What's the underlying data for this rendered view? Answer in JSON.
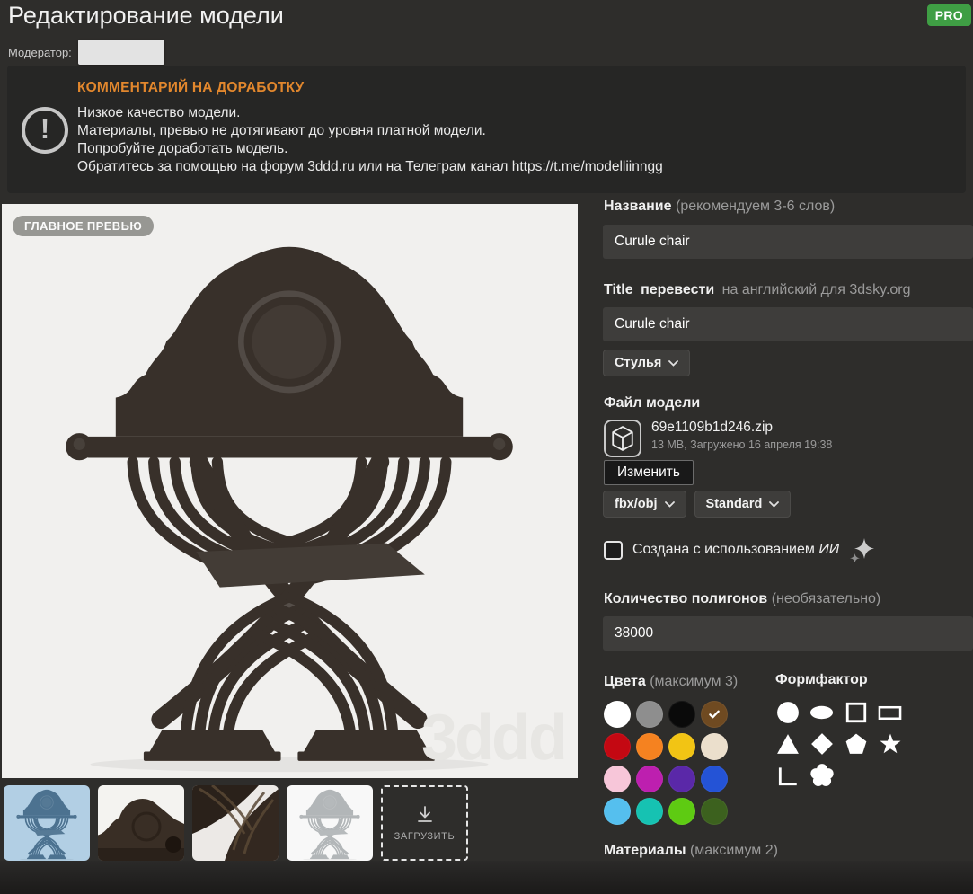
{
  "page": {
    "title": "Редактирование модели",
    "pro_badge": "PRO",
    "moderator_label": "Модератор:"
  },
  "warning": {
    "heading": "КОММЕНТАРИЙ НА ДОРАБОТКУ",
    "lines": [
      "Низкое качество модели.",
      "Материалы, превью не дотягивают до уровня платной модели.",
      "Попробуйте доработать модель.",
      "Обратитесь за помощью на форум 3ddd.ru или на Телеграм канал https://t.me/modelliinngg"
    ]
  },
  "preview": {
    "main_badge": "ГЛАВНОЕ ПРЕВЬЮ",
    "watermark": "3ddd",
    "upload_label": "ЗАГРУЗИТЬ",
    "thumbnails": [
      {
        "id": 1,
        "variant": "blue-selected"
      },
      {
        "id": 2,
        "variant": "crest-closeup"
      },
      {
        "id": 3,
        "variant": "legs-closeup"
      },
      {
        "id": 4,
        "variant": "wireframe"
      }
    ]
  },
  "form": {
    "name": {
      "label": "Название",
      "hint": "(рекомендуем 3-6 слов)",
      "value": "Curule chair"
    },
    "title_en": {
      "label": "Title",
      "action": "перевести",
      "hint": "на английский для 3dsky.org",
      "value": "Curule chair"
    },
    "category": {
      "value": "Стулья"
    },
    "file": {
      "section_label": "Файл модели",
      "filename": "69e1109b1d246.zip",
      "meta": "13 MB, Загружено 16 апреля 19:38",
      "change_button": "Изменить",
      "format_dropdown": "fbx/obj",
      "render_dropdown": "Standard"
    },
    "ai_checkbox": {
      "label_prefix": "Создана с использованием",
      "label_em": "ИИ",
      "checked": false
    },
    "polygons": {
      "label": "Количество полигонов",
      "hint": "(необязательно)",
      "value": "38000"
    },
    "colors": {
      "label": "Цвета",
      "hint": "(максимум 3)",
      "swatches": [
        {
          "name": "white",
          "hex": "#ffffff",
          "selected": false
        },
        {
          "name": "gray",
          "hex": "#8e8e8e",
          "selected": false
        },
        {
          "name": "black",
          "hex": "#0a0a0a",
          "selected": false
        },
        {
          "name": "brown",
          "hex": "#6f4a21",
          "selected": true
        },
        {
          "name": "red",
          "hex": "#c40812",
          "selected": false
        },
        {
          "name": "orange",
          "hex": "#f58220",
          "selected": false
        },
        {
          "name": "yellow",
          "hex": "#f2c414",
          "selected": false
        },
        {
          "name": "beige",
          "hex": "#ebdfcc",
          "selected": false
        },
        {
          "name": "pink",
          "hex": "#f7c6d9",
          "selected": false
        },
        {
          "name": "magenta",
          "hex": "#bd1faf",
          "selected": false
        },
        {
          "name": "purple",
          "hex": "#5a28a8",
          "selected": false
        },
        {
          "name": "blue",
          "hex": "#2453d6",
          "selected": false
        },
        {
          "name": "sky-blue",
          "hex": "#55bfee",
          "selected": false
        },
        {
          "name": "turquoise",
          "hex": "#16c2b2",
          "selected": false
        },
        {
          "name": "green",
          "hex": "#5ecb12",
          "selected": false
        },
        {
          "name": "dark-green",
          "hex": "#3c611e",
          "selected": false
        }
      ]
    },
    "form_factor": {
      "label": "Формфактор",
      "shapes": [
        "circle",
        "ellipse",
        "square",
        "rectangle",
        "triangle",
        "diamond",
        "pentagon",
        "star",
        "l-shape",
        "flower"
      ]
    },
    "materials": {
      "label": "Материалы",
      "hint": "(максимум 2)"
    }
  },
  "theme": {
    "pro_green": "#3f9e44",
    "warning_orange": "#e2872d",
    "page_bg": "#2e2d2b",
    "preview_bg": "#f1f0ee"
  }
}
